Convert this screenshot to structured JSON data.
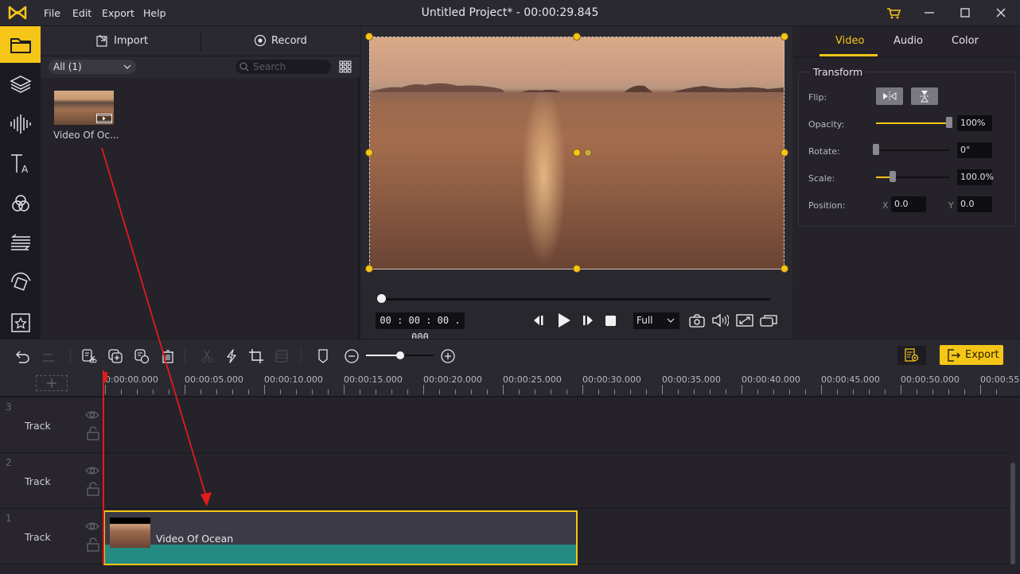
{
  "app": {
    "title": "Untitled Project* - 00:00:29.845",
    "menu": [
      "File",
      "Edit",
      "Export",
      "Help"
    ],
    "accent_color": "#f5c518"
  },
  "window_controls": [
    "cart-icon",
    "minimize-icon",
    "maximize-icon",
    "close-icon"
  ],
  "rail": {
    "items": [
      {
        "icon": "folder-icon",
        "label": "Media",
        "active": true
      },
      {
        "icon": "layers-icon",
        "label": "Layers"
      },
      {
        "icon": "audio-wave-icon",
        "label": "Audio"
      },
      {
        "icon": "text-icon",
        "label": "Text"
      },
      {
        "icon": "filters-icon",
        "label": "Filters"
      },
      {
        "icon": "transitions-icon",
        "label": "Transitions"
      },
      {
        "icon": "motion-icon",
        "label": "Motion"
      },
      {
        "icon": "sticker-icon",
        "label": "Elements"
      }
    ]
  },
  "media": {
    "import_label": "Import",
    "record_label": "Record",
    "filter_value": "All (1)",
    "search_placeholder": "Search",
    "items": [
      {
        "name": "Video Of Oc...",
        "type": "video"
      }
    ]
  },
  "preview": {
    "timecode": "00 : 00 : 00 . 000",
    "quality": "Full",
    "progress": 0
  },
  "properties": {
    "tabs": [
      "Video",
      "Audio",
      "Color"
    ],
    "active_tab": "Video",
    "section_title": "Transform",
    "flip_label": "Flip:",
    "opacity_label": "Opacity:",
    "opacity_value": "100%",
    "opacity_fraction": 1.0,
    "rotate_label": "Rotate:",
    "rotate_value": "0°",
    "rotate_fraction": 0.0,
    "scale_label": "Scale:",
    "scale_value": "100.0%",
    "scale_fraction": 0.23,
    "position_label": "Position:",
    "x_label": "X",
    "x_value": "0.0",
    "y_label": "Y",
    "y_value": "0.0"
  },
  "timeline": {
    "export_label": "Export",
    "zoom_fraction": 0.5,
    "ruler": [
      "0:00:00.000",
      "00:00:05.000",
      "00:00:10.000",
      "00:00:15.000",
      "00:00:20.000",
      "00:00:25.000",
      "00:00:30.000",
      "00:00:35.000",
      "00:00:40.000",
      "00:00:45.000",
      "00:00:50.000",
      "00:00:55"
    ],
    "tracks": [
      {
        "number": "3",
        "name": "Track"
      },
      {
        "number": "2",
        "name": "Track"
      },
      {
        "number": "1",
        "name": "Track"
      }
    ],
    "clip": {
      "label": "Video Of Ocean",
      "track": "1"
    }
  }
}
